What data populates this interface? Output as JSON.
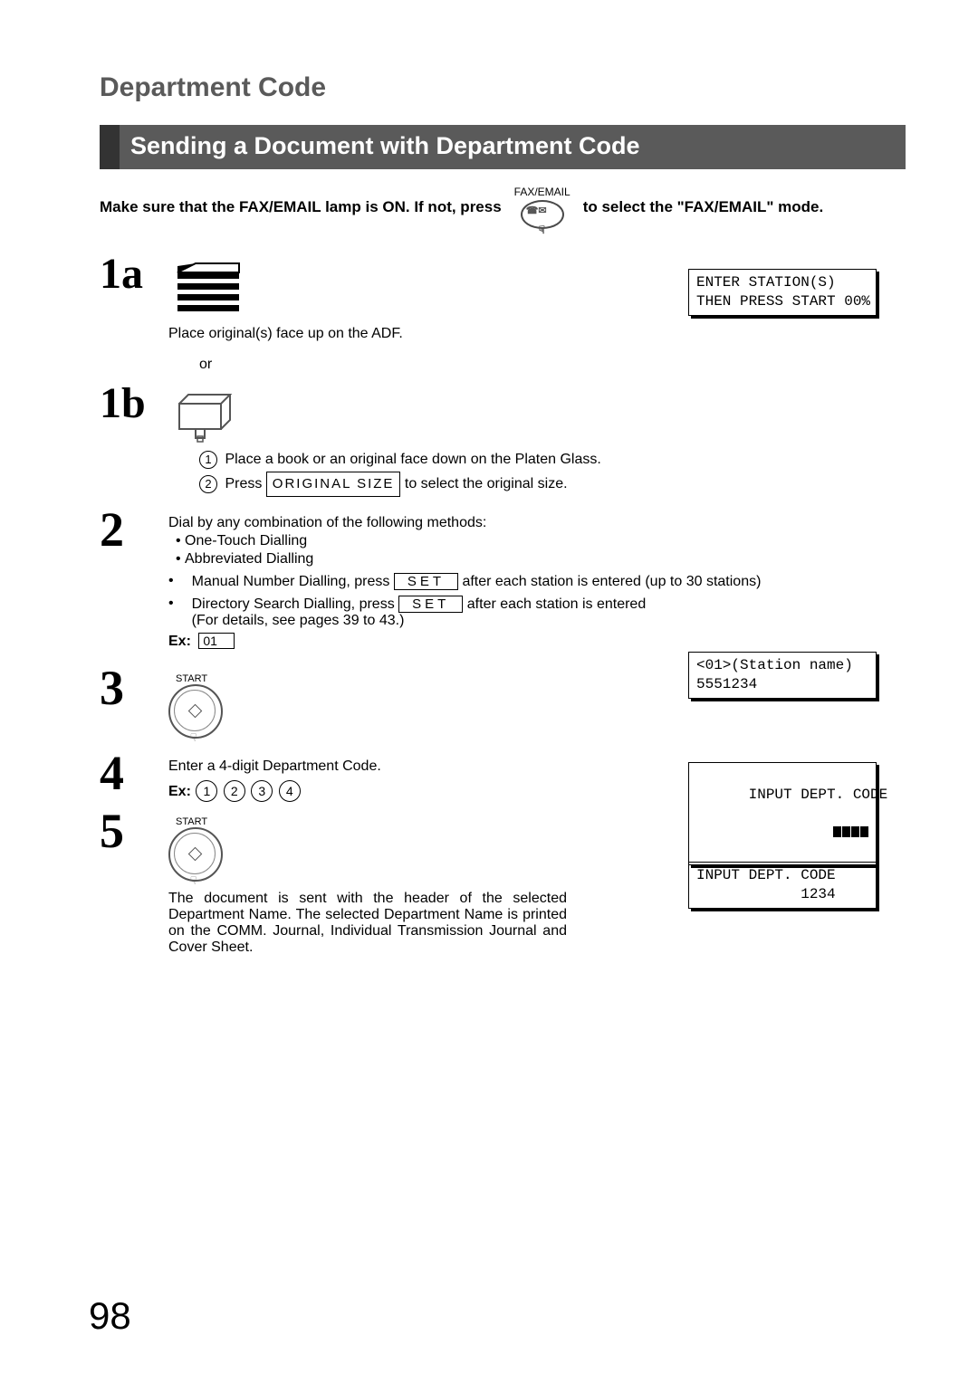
{
  "header": {
    "section": "Department Code",
    "title": "Sending a Document with Department Code"
  },
  "intro": {
    "before": "Make sure that the FAX/EMAIL lamp is ON.  If not, press",
    "icon_label": "FAX/EMAIL",
    "after": " to select the \"FAX/EMAIL\" mode."
  },
  "steps": {
    "s1a": {
      "num": "1a",
      "caption": "Place original(s) face up on the ADF.",
      "or": "or"
    },
    "s1b": {
      "num": "1b",
      "line1": "Place a book or an original face down on the Platen Glass.",
      "line2_pre": "Press ",
      "line2_button": "ORIGINAL  SIZE",
      "line2_post": " to select the original size."
    },
    "s2": {
      "num": "2",
      "intro": "Dial by any combination of the following methods:",
      "b1": "One-Touch Dialling",
      "b2": "Abbreviated Dialling",
      "b3_pre": "Manual Number Dialling, press ",
      "b3_btn": "SET",
      "b3_post": " after each station is entered (up to 30 stations)",
      "b4_pre": "Directory Search Dialling, press ",
      "b4_btn": "SET",
      "b4_post": " after each station is entered",
      "b4_note": "(For details, see pages 39 to 43.)",
      "ex_label": "Ex:",
      "ex_value": "01"
    },
    "s3": {
      "num": "3",
      "start_label": "START"
    },
    "s4": {
      "num": "4",
      "line1": "Enter a 4-digit Department Code.",
      "ex_label": "Ex:",
      "d1": "1",
      "d2": "2",
      "d3": "3",
      "d4": "4"
    },
    "s5": {
      "num": "5",
      "start_label": "START",
      "final": "The document is sent with the header of the selected Department Name.  The selected Department Name is printed on the COMM. Journal, Individual Transmission Journal and Cover Sheet."
    }
  },
  "lcd": {
    "d1": "ENTER STATION(S)\nTHEN PRESS START 00%",
    "d2": "<01>(Station name)\n5551234",
    "d3_line1": "INPUT DEPT. CODE",
    "d4": "INPUT DEPT. CODE\n            1234"
  },
  "page_number": "98"
}
